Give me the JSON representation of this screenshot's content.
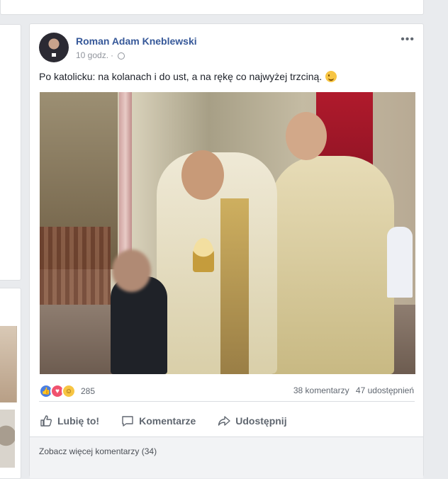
{
  "post": {
    "author": "Roman Adam Kneblewski",
    "time": "10 godz.",
    "separator": "·",
    "text": "Po katolicku: na kolanach i do ust, a na rękę co najwyżej trzciną.",
    "emoji_icon": "wink-emoji",
    "more_icon": "•••",
    "photo_icon": "photo-communion"
  },
  "reactions": {
    "icons": [
      "like-icon",
      "love-icon",
      "haha-icon"
    ],
    "count": "285",
    "comments": "38 komentarzy",
    "shares": "47 udostępnień"
  },
  "actions": {
    "like": "Lubię to!",
    "comment": "Komentarze",
    "share": "Udostępnij"
  },
  "comments": {
    "more_label": "Zobacz więcej komentarzy (34)"
  },
  "colors": {
    "link": "#365899",
    "background": "#e9ebee",
    "like": "#4a7fe3",
    "love": "#f0526f",
    "haha": "#f7c543"
  }
}
